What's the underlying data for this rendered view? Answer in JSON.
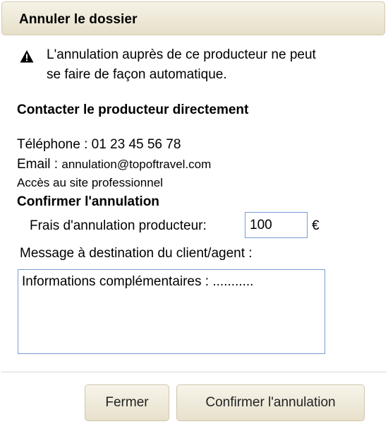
{
  "dialog": {
    "title": "Annuler le dossier"
  },
  "warning": {
    "icon": "warning-icon",
    "line1": "L'annulation auprès de ce producteur ne peut",
    "line2": "se faire de façon automatique."
  },
  "contact": {
    "heading": "Contacter le producteur directement",
    "phone": "Téléphone : 01 23 45 56 78",
    "email_label": "Email : ",
    "email_value": "annulation@topoftravel.com",
    "pro_link": "Accès au site professionnel"
  },
  "confirm": {
    "heading": "Confirmer l'annulation",
    "fee_label": "Frais d'annulation producteur:",
    "fee_value": "100",
    "currency": "€",
    "message_label": "Message à destination du client/agent :",
    "message_value": "Informations complémentaires : ..........."
  },
  "footer": {
    "close_label": "Fermer",
    "confirm_label": "Confirmer l'annulation"
  },
  "colors": {
    "titlebar": "#ebe5d2",
    "input_border": "#7a9cd3",
    "button": "#ede7d5"
  }
}
